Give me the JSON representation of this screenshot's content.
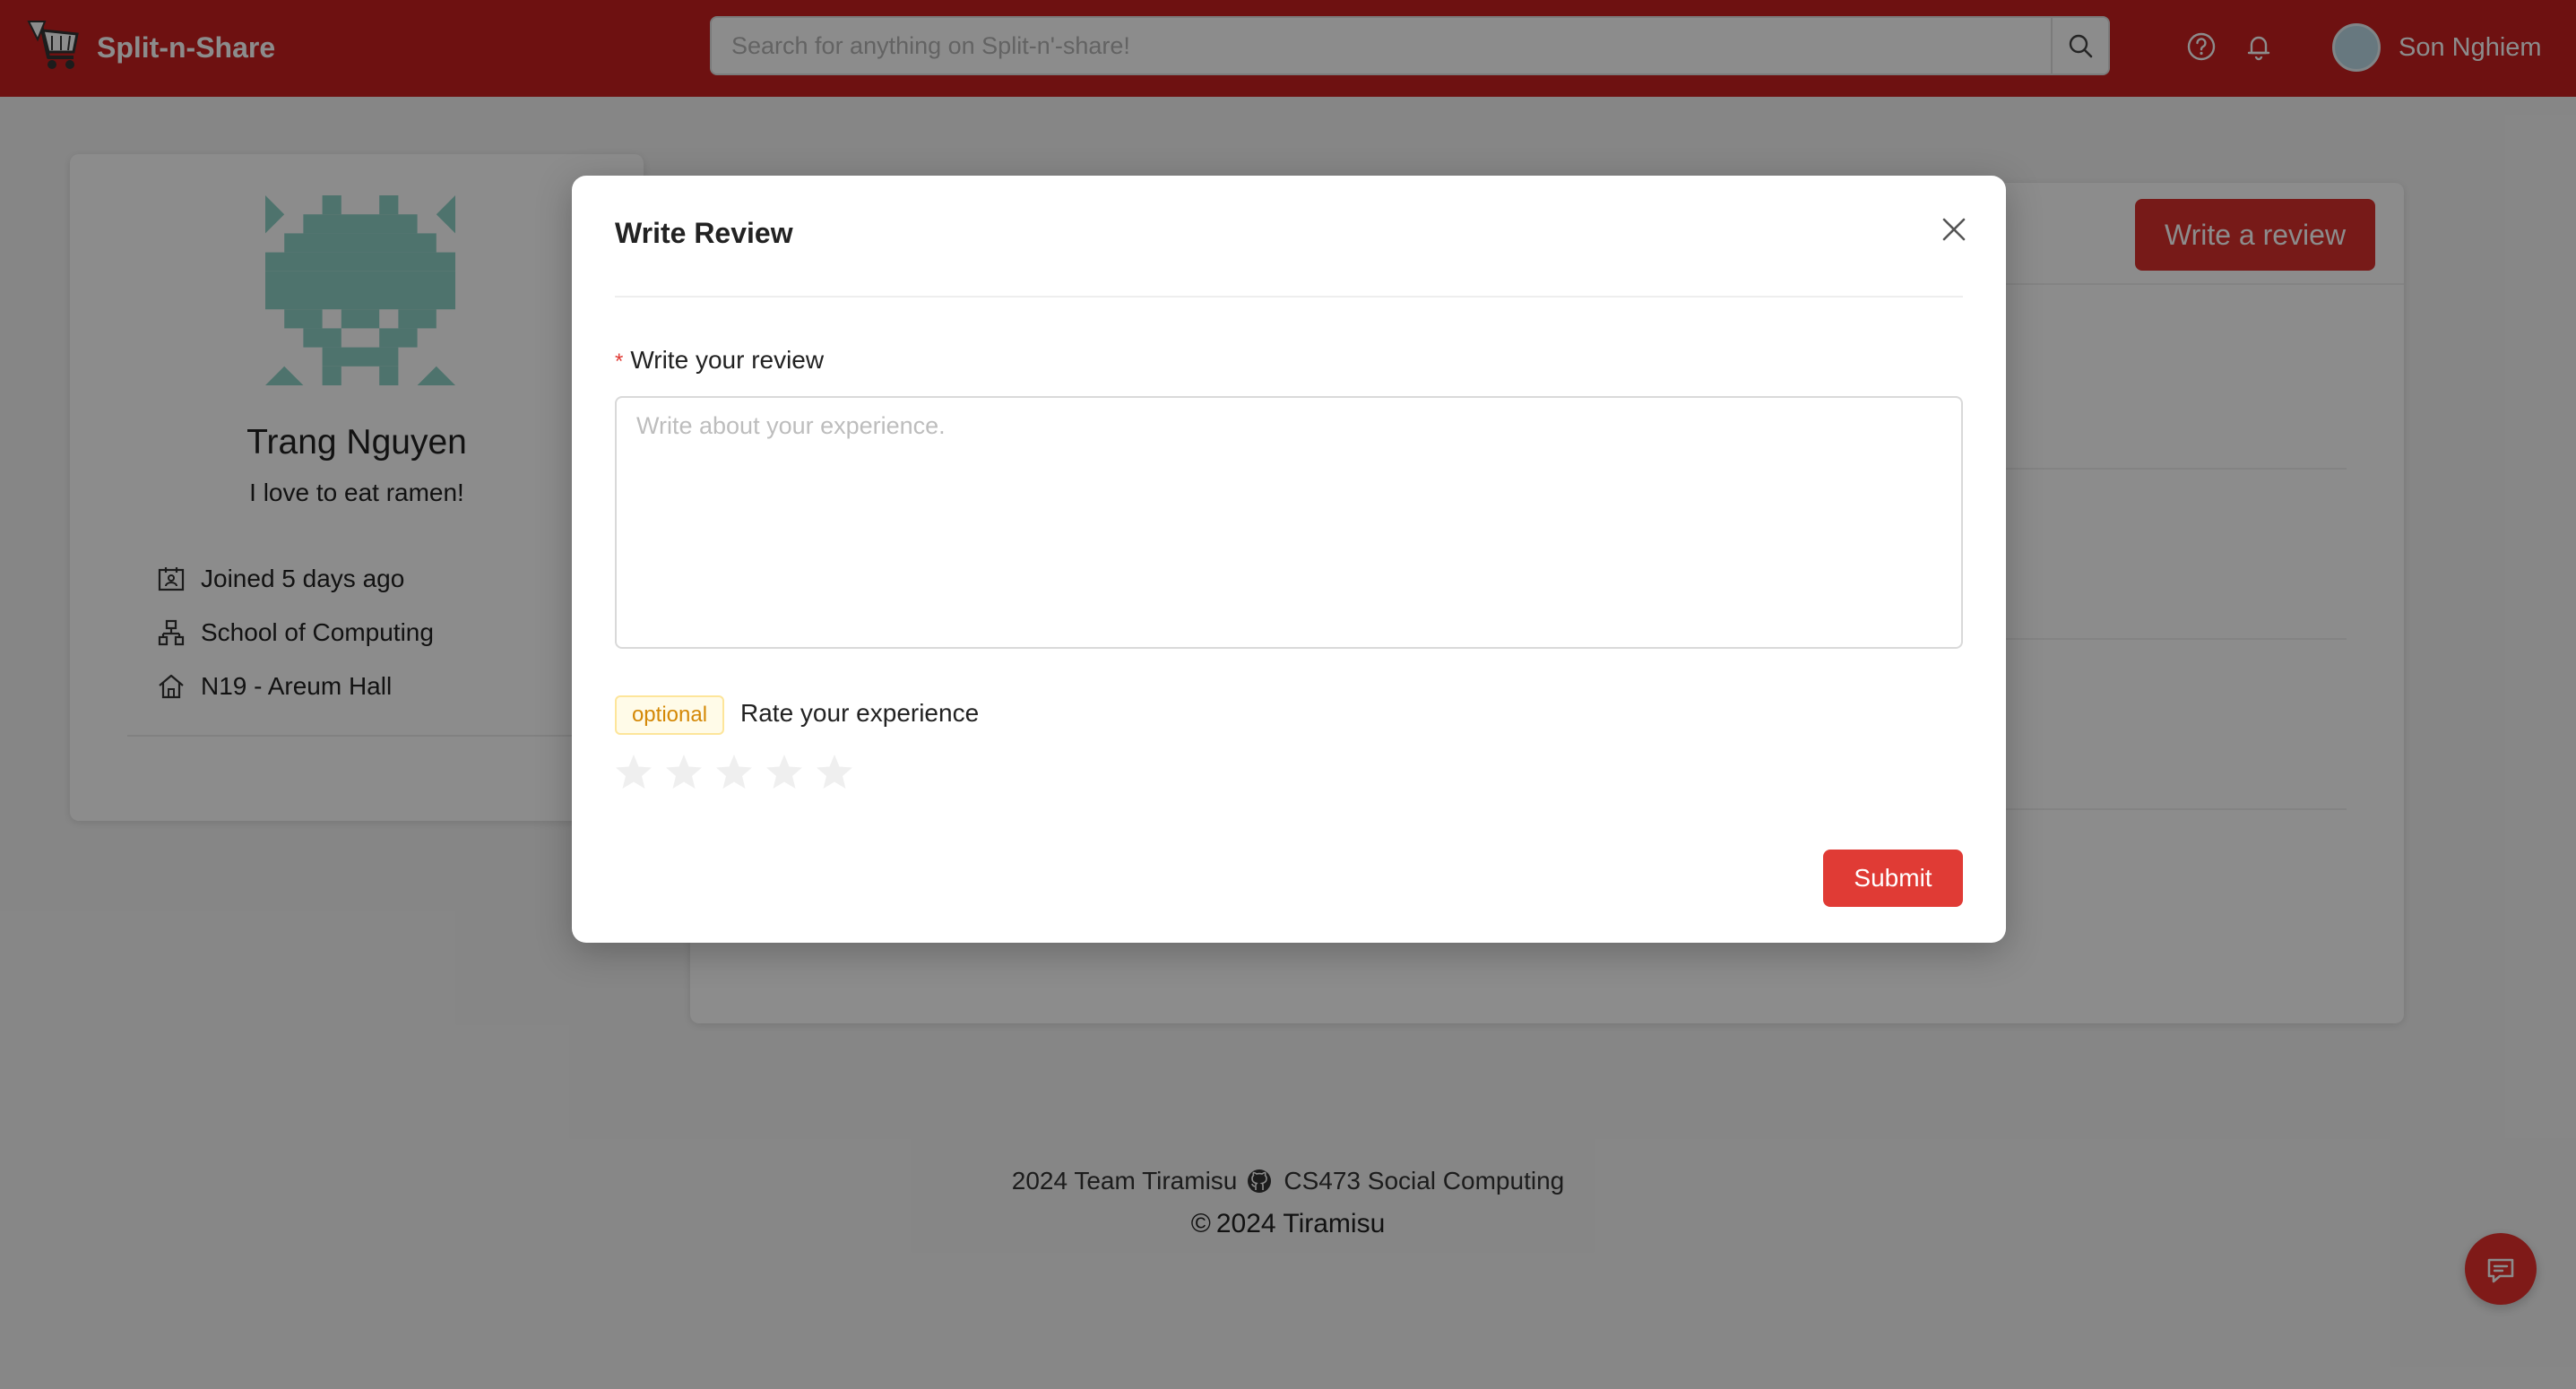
{
  "header": {
    "brand_name": "Split-n-Share",
    "search_placeholder": "Search for anything on Split-n'-share!",
    "user_name": "Son Nghiem"
  },
  "profile": {
    "name": "Trang Nguyen",
    "bio": "I love to eat ramen!",
    "meta": [
      {
        "icon": "calendar-user-icon",
        "text": "Joined 5 days ago"
      },
      {
        "icon": "organization-icon",
        "text": "School of Computing"
      },
      {
        "icon": "home-icon",
        "text": "N19 - Areum Hall"
      }
    ],
    "identicon_color": "#8ed1c6"
  },
  "reviews": {
    "write_button": "Write a review"
  },
  "modal": {
    "title": "Write Review",
    "review_label": "Write your review",
    "required_mark": "*",
    "review_placeholder": "Write about your experience.",
    "optional_tag": "optional",
    "rate_label": "Rate your experience",
    "rating": 0,
    "max_rating": 5,
    "submit_label": "Submit"
  },
  "footer": {
    "team_text": "2024 Team Tiramisu",
    "course_text": "CS473 Social Computing",
    "copyright_symbol": "©",
    "copyright_text": "2024 Tiramisu"
  },
  "colors": {
    "brand": "#c8201f",
    "primary_button": "#e03b35",
    "optional_tag_text": "#d48806"
  }
}
